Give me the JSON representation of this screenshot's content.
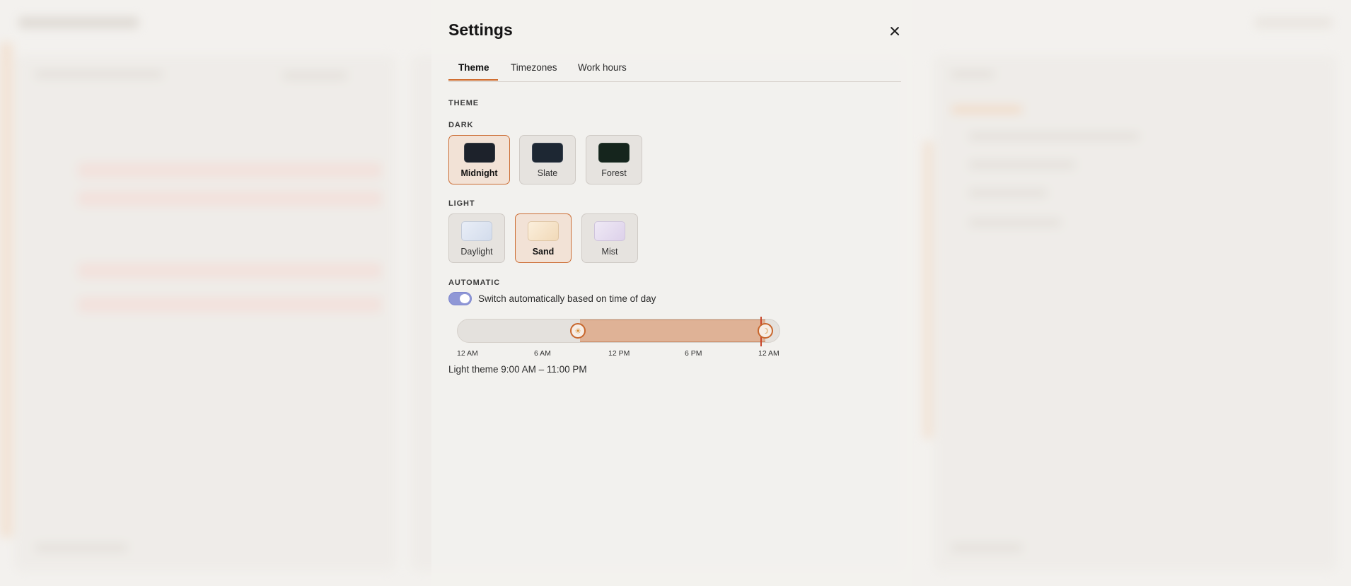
{
  "settings": {
    "title": "Settings",
    "close_icon": "close-icon",
    "tabs": [
      {
        "label": "Theme",
        "active": true
      },
      {
        "label": "Timezones",
        "active": false
      },
      {
        "label": "Work hours",
        "active": false
      }
    ],
    "theme_section_label": "THEME",
    "dark": {
      "label": "DARK",
      "options": [
        {
          "name": "Midnight",
          "color": "#1d222b",
          "selected": true
        },
        {
          "name": "Slate",
          "color": "#1d2733",
          "selected": false
        },
        {
          "name": "Forest",
          "color": "#15251d",
          "selected": false
        }
      ]
    },
    "light": {
      "label": "LIGHT",
      "options": [
        {
          "name": "Daylight",
          "color": "#dfe6f1",
          "selected": false
        },
        {
          "name": "Sand",
          "color": "#f7e6cf",
          "selected": true
        },
        {
          "name": "Mist",
          "color": "#e7dff0",
          "selected": false
        }
      ]
    },
    "automatic": {
      "label": "AUTOMATIC",
      "toggle_label": "Switch automatically based on time of day",
      "toggle_on": true,
      "timeline_ticks": [
        "12 AM",
        "6 AM",
        "12 PM",
        "6 PM",
        "12 AM"
      ],
      "light_start": "9:00 AM",
      "light_end": "11:00 PM",
      "sun_icon": "sun-icon",
      "moon_icon": "moon-icon",
      "range_text": "Light theme 9:00 AM – 11:00 PM"
    },
    "accent_color": "#cf6a2b"
  }
}
